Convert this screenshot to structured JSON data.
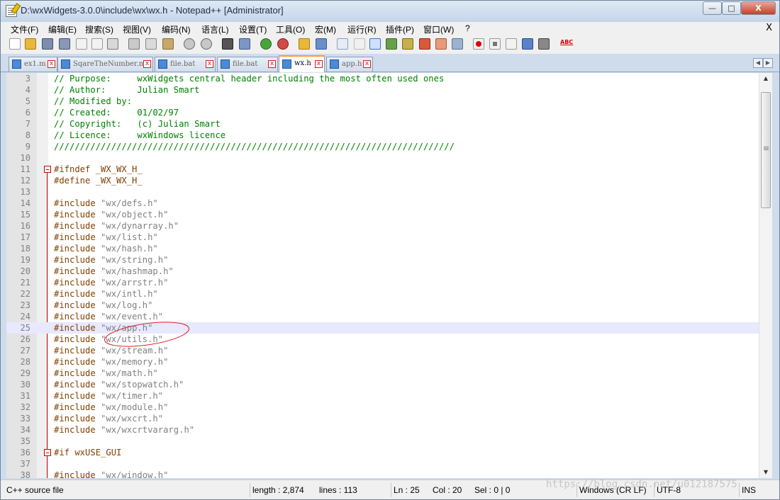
{
  "window": {
    "title": "D:\\wxWidgets-3.0.0\\include\\wx\\wx.h - Notepad++ [Administrator]",
    "controls": {
      "minimize": "—",
      "maximize": "□",
      "close": "X"
    }
  },
  "menu": {
    "items": [
      "文件(F)",
      "编辑(E)",
      "搜索(S)",
      "视图(V)",
      "编码(N)",
      "语言(L)",
      "设置(T)",
      "工具(O)",
      "宏(M)",
      "运行(R)",
      "插件(P)",
      "窗口(W)",
      "?"
    ],
    "close": "X"
  },
  "toolbar": {
    "buttons": [
      "new-icon",
      "open-icon",
      "save-icon",
      "save-all-icon",
      "close-icon",
      "close-all-icon",
      "print-icon",
      "cut-icon",
      "copy-icon",
      "paste-icon",
      "undo-icon",
      "redo-icon",
      "find-icon",
      "replace-icon",
      "zoom-in-icon",
      "zoom-out-icon",
      "sync-v-icon",
      "sync-h-icon",
      "word-wrap-icon",
      "all-chars-icon",
      "indent-guide-icon",
      "udl-icon",
      "doc-map-icon",
      "function-list-icon",
      "folder-icon",
      "monitor-icon",
      "record-macro-icon",
      "stop-macro-icon",
      "play-macro-icon",
      "run-multiple-icon",
      "save-macro-icon",
      "spellcheck-icon"
    ],
    "spellcheck_label": "ABC"
  },
  "tabs": [
    {
      "label": "ex1.m",
      "active": false
    },
    {
      "label": "SqareTheNumber.m",
      "active": false
    },
    {
      "label": "file.bat",
      "active": false
    },
    {
      "label": "file.bat",
      "active": false
    },
    {
      "label": "wx.h",
      "active": true
    },
    {
      "label": "app.h",
      "active": false
    }
  ],
  "tab_close": "x",
  "tab_nav": {
    "left": "◀",
    "right": "▶"
  },
  "editor": {
    "current_line": 25,
    "lines": [
      {
        "n": "3",
        "t": "// Purpose:     wxWidgets central header including the most often used ones",
        "k": "comment"
      },
      {
        "n": "4",
        "t": "// Author:      Julian Smart",
        "k": "comment"
      },
      {
        "n": "5",
        "t": "// Modified by:",
        "k": "comment"
      },
      {
        "n": "6",
        "t": "// Created:     01/02/97",
        "k": "comment"
      },
      {
        "n": "7",
        "t": "// Copyright:   (c) Julian Smart",
        "k": "comment"
      },
      {
        "n": "8",
        "t": "// Licence:     wxWindows licence",
        "k": "comment"
      },
      {
        "n": "9",
        "t": "/////////////////////////////////////////////////////////////////////////////",
        "k": "comment"
      },
      {
        "n": "10",
        "t": "",
        "k": "blank"
      },
      {
        "n": "11",
        "t": "#ifndef _WX_WX_H_",
        "k": "pre"
      },
      {
        "n": "12",
        "t": "#define _WX_WX_H_",
        "k": "pre"
      },
      {
        "n": "13",
        "t": "",
        "k": "blank"
      },
      {
        "n": "14",
        "t": "#include \"wx/defs.h\"",
        "k": "inc"
      },
      {
        "n": "15",
        "t": "#include \"wx/object.h\"",
        "k": "inc"
      },
      {
        "n": "16",
        "t": "#include \"wx/dynarray.h\"",
        "k": "inc"
      },
      {
        "n": "17",
        "t": "#include \"wx/list.h\"",
        "k": "inc"
      },
      {
        "n": "18",
        "t": "#include \"wx/hash.h\"",
        "k": "inc"
      },
      {
        "n": "19",
        "t": "#include \"wx/string.h\"",
        "k": "inc"
      },
      {
        "n": "20",
        "t": "#include \"wx/hashmap.h\"",
        "k": "inc"
      },
      {
        "n": "21",
        "t": "#include \"wx/arrstr.h\"",
        "k": "inc"
      },
      {
        "n": "22",
        "t": "#include \"wx/intl.h\"",
        "k": "inc"
      },
      {
        "n": "23",
        "t": "#include \"wx/log.h\"",
        "k": "inc"
      },
      {
        "n": "24",
        "t": "#include \"wx/event.h\"",
        "k": "inc"
      },
      {
        "n": "25",
        "t": "#include \"wx/app.h\"",
        "k": "inc"
      },
      {
        "n": "26",
        "t": "#include \"wx/utils.h\"",
        "k": "inc"
      },
      {
        "n": "27",
        "t": "#include \"wx/stream.h\"",
        "k": "inc"
      },
      {
        "n": "28",
        "t": "#include \"wx/memory.h\"",
        "k": "inc"
      },
      {
        "n": "29",
        "t": "#include \"wx/math.h\"",
        "k": "inc"
      },
      {
        "n": "30",
        "t": "#include \"wx/stopwatch.h\"",
        "k": "inc"
      },
      {
        "n": "31",
        "t": "#include \"wx/timer.h\"",
        "k": "inc"
      },
      {
        "n": "32",
        "t": "#include \"wx/module.h\"",
        "k": "inc"
      },
      {
        "n": "33",
        "t": "#include \"wx/wxcrt.h\"",
        "k": "inc"
      },
      {
        "n": "34",
        "t": "#include \"wx/wxcrtvararg.h\"",
        "k": "inc"
      },
      {
        "n": "35",
        "t": "",
        "k": "blank"
      },
      {
        "n": "36",
        "t": "#if wxUSE_GUI",
        "k": "pre"
      },
      {
        "n": "37",
        "t": "",
        "k": "blank"
      },
      {
        "n": "38",
        "t": "#include \"wx/window.h\"",
        "k": "inc"
      }
    ]
  },
  "scrollbar": {
    "up": "▲",
    "down": "▼",
    "position": 0.08
  },
  "statusbar": {
    "file_type": "C++ source file",
    "length": "length : 2,874",
    "lines": "lines : 113",
    "ln": "Ln : 25",
    "col": "Col : 20",
    "sel": "Sel : 0 | 0",
    "eol": "Windows (CR LF)",
    "encoding": "UTF-8",
    "mode": "INS"
  },
  "watermark": "https://blog.csdn.net/u012187575"
}
